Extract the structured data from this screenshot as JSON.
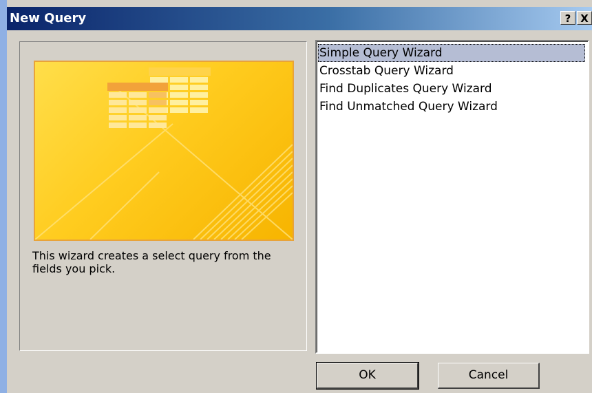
{
  "window": {
    "title": "New Query",
    "help_label": "?",
    "close_label": "X"
  },
  "description": "This wizard creates a select query from the fields you pick.",
  "list": {
    "items": [
      "Simple Query Wizard",
      "Crosstab Query Wizard",
      "Find Duplicates Query Wizard",
      "Find Unmatched Query Wizard"
    ],
    "selected": "Simple Query Wizard"
  },
  "buttons": {
    "ok": "OK",
    "cancel": "Cancel"
  },
  "colors": {
    "title_gradient_start": "#0a246a",
    "title_gradient_end": "#a6caf0",
    "dialog_bg": "#d4d0c8",
    "selection_bg": "#b5bdd4",
    "preview_yellow": "#ffcc1f"
  },
  "icons": {
    "preview": "table-grid-icon"
  }
}
